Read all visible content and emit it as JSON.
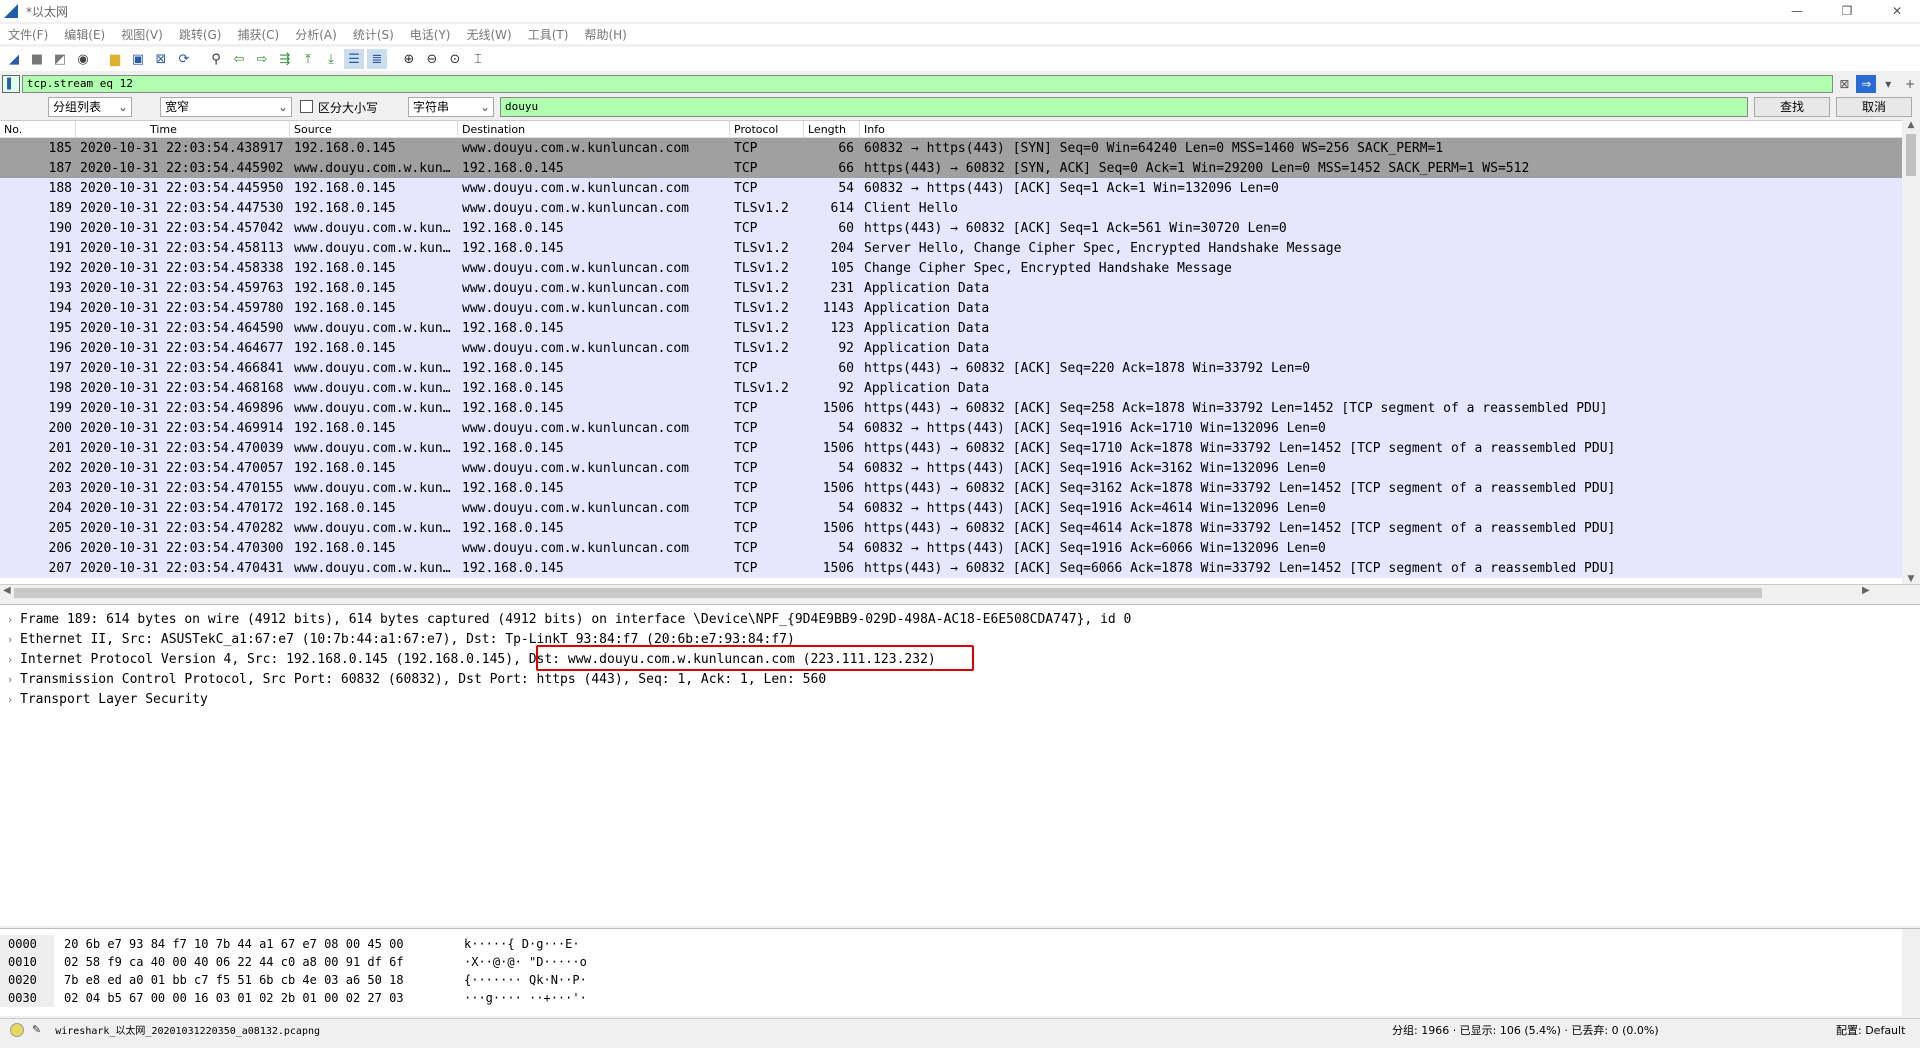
{
  "window": {
    "title": "*以太网",
    "minimize": "—",
    "restore": "❐",
    "close": "✕"
  },
  "menu": [
    "文件(F)",
    "编辑(E)",
    "视图(V)",
    "跳转(G)",
    "捕获(C)",
    "分析(A)",
    "统计(S)",
    "电话(Y)",
    "无线(W)",
    "工具(T)",
    "帮助(H)"
  ],
  "filter": {
    "value": "tcp.stream eq 12"
  },
  "find": {
    "scope": "分组列表",
    "charset": "宽窄",
    "case_label": "区分大小写",
    "type": "字符串",
    "query": "douyu",
    "find_button": "查找",
    "cancel_button": "取消"
  },
  "columns": {
    "no": "No.",
    "time": "Time",
    "source": "Source",
    "destination": "Destination",
    "protocol": "Protocol",
    "length": "Length",
    "info": "Info"
  },
  "packets": [
    {
      "no": "185",
      "time": "2020-10-31 22:03:54.438917",
      "src": "192.168.0.145",
      "dst": "www.douyu.com.w.kunluncan.com",
      "proto": "TCP",
      "len": "66",
      "info": "60832 → https(443) [SYN] Seq=0 Win=64240 Len=0 MSS=1460 WS=256 SACK_PERM=1"
    },
    {
      "no": "187",
      "time": "2020-10-31 22:03:54.445902",
      "src": "www.douyu.com.w.kun…",
      "dst": "192.168.0.145",
      "proto": "TCP",
      "len": "66",
      "info": "https(443) → 60832 [SYN, ACK] Seq=0 Ack=1 Win=29200 Len=0 MSS=1452 SACK_PERM=1 WS=512"
    },
    {
      "no": "188",
      "time": "2020-10-31 22:03:54.445950",
      "src": "192.168.0.145",
      "dst": "www.douyu.com.w.kunluncan.com",
      "proto": "TCP",
      "len": "54",
      "info": "60832 → https(443) [ACK] Seq=1 Ack=1 Win=132096 Len=0"
    },
    {
      "no": "189",
      "time": "2020-10-31 22:03:54.447530",
      "src": "192.168.0.145",
      "dst": "www.douyu.com.w.kunluncan.com",
      "proto": "TLSv1.2",
      "len": "614",
      "info": "Client Hello"
    },
    {
      "no": "190",
      "time": "2020-10-31 22:03:54.457042",
      "src": "www.douyu.com.w.kun…",
      "dst": "192.168.0.145",
      "proto": "TCP",
      "len": "60",
      "info": "https(443) → 60832 [ACK] Seq=1 Ack=561 Win=30720 Len=0"
    },
    {
      "no": "191",
      "time": "2020-10-31 22:03:54.458113",
      "src": "www.douyu.com.w.kun…",
      "dst": "192.168.0.145",
      "proto": "TLSv1.2",
      "len": "204",
      "info": "Server Hello, Change Cipher Spec, Encrypted Handshake Message"
    },
    {
      "no": "192",
      "time": "2020-10-31 22:03:54.458338",
      "src": "192.168.0.145",
      "dst": "www.douyu.com.w.kunluncan.com",
      "proto": "TLSv1.2",
      "len": "105",
      "info": "Change Cipher Spec, Encrypted Handshake Message"
    },
    {
      "no": "193",
      "time": "2020-10-31 22:03:54.459763",
      "src": "192.168.0.145",
      "dst": "www.douyu.com.w.kunluncan.com",
      "proto": "TLSv1.2",
      "len": "231",
      "info": "Application Data"
    },
    {
      "no": "194",
      "time": "2020-10-31 22:03:54.459780",
      "src": "192.168.0.145",
      "dst": "www.douyu.com.w.kunluncan.com",
      "proto": "TLSv1.2",
      "len": "1143",
      "info": "Application Data"
    },
    {
      "no": "195",
      "time": "2020-10-31 22:03:54.464590",
      "src": "www.douyu.com.w.kun…",
      "dst": "192.168.0.145",
      "proto": "TLSv1.2",
      "len": "123",
      "info": "Application Data"
    },
    {
      "no": "196",
      "time": "2020-10-31 22:03:54.464677",
      "src": "192.168.0.145",
      "dst": "www.douyu.com.w.kunluncan.com",
      "proto": "TLSv1.2",
      "len": "92",
      "info": "Application Data"
    },
    {
      "no": "197",
      "time": "2020-10-31 22:03:54.466841",
      "src": "www.douyu.com.w.kun…",
      "dst": "192.168.0.145",
      "proto": "TCP",
      "len": "60",
      "info": "https(443) → 60832 [ACK] Seq=220 Ack=1878 Win=33792 Len=0"
    },
    {
      "no": "198",
      "time": "2020-10-31 22:03:54.468168",
      "src": "www.douyu.com.w.kun…",
      "dst": "192.168.0.145",
      "proto": "TLSv1.2",
      "len": "92",
      "info": "Application Data"
    },
    {
      "no": "199",
      "time": "2020-10-31 22:03:54.469896",
      "src": "www.douyu.com.w.kun…",
      "dst": "192.168.0.145",
      "proto": "TCP",
      "len": "1506",
      "info": "https(443) → 60832 [ACK] Seq=258 Ack=1878 Win=33792 Len=1452 [TCP segment of a reassembled PDU]"
    },
    {
      "no": "200",
      "time": "2020-10-31 22:03:54.469914",
      "src": "192.168.0.145",
      "dst": "www.douyu.com.w.kunluncan.com",
      "proto": "TCP",
      "len": "54",
      "info": "60832 → https(443) [ACK] Seq=1916 Ack=1710 Win=132096 Len=0"
    },
    {
      "no": "201",
      "time": "2020-10-31 22:03:54.470039",
      "src": "www.douyu.com.w.kun…",
      "dst": "192.168.0.145",
      "proto": "TCP",
      "len": "1506",
      "info": "https(443) → 60832 [ACK] Seq=1710 Ack=1878 Win=33792 Len=1452 [TCP segment of a reassembled PDU]"
    },
    {
      "no": "202",
      "time": "2020-10-31 22:03:54.470057",
      "src": "192.168.0.145",
      "dst": "www.douyu.com.w.kunluncan.com",
      "proto": "TCP",
      "len": "54",
      "info": "60832 → https(443) [ACK] Seq=1916 Ack=3162 Win=132096 Len=0"
    },
    {
      "no": "203",
      "time": "2020-10-31 22:03:54.470155",
      "src": "www.douyu.com.w.kun…",
      "dst": "192.168.0.145",
      "proto": "TCP",
      "len": "1506",
      "info": "https(443) → 60832 [ACK] Seq=3162 Ack=1878 Win=33792 Len=1452 [TCP segment of a reassembled PDU]"
    },
    {
      "no": "204",
      "time": "2020-10-31 22:03:54.470172",
      "src": "192.168.0.145",
      "dst": "www.douyu.com.w.kunluncan.com",
      "proto": "TCP",
      "len": "54",
      "info": "60832 → https(443) [ACK] Seq=1916 Ack=4614 Win=132096 Len=0"
    },
    {
      "no": "205",
      "time": "2020-10-31 22:03:54.470282",
      "src": "www.douyu.com.w.kun…",
      "dst": "192.168.0.145",
      "proto": "TCP",
      "len": "1506",
      "info": "https(443) → 60832 [ACK] Seq=4614 Ack=1878 Win=33792 Len=1452 [TCP segment of a reassembled PDU]"
    },
    {
      "no": "206",
      "time": "2020-10-31 22:03:54.470300",
      "src": "192.168.0.145",
      "dst": "www.douyu.com.w.kunluncan.com",
      "proto": "TCP",
      "len": "54",
      "info": "60832 → https(443) [ACK] Seq=1916 Ack=6066 Win=132096 Len=0"
    },
    {
      "no": "207",
      "time": "2020-10-31 22:03:54.470431",
      "src": "www.douyu.com.w.kun…",
      "dst": "192.168.0.145",
      "proto": "TCP",
      "len": "1506",
      "info": "https(443) → 60832 [ACK] Seq=6066 Ack=1878 Win=33792 Len=1452 [TCP segment of a reassembled PDU]"
    }
  ],
  "details": [
    "Frame 189: 614 bytes on wire (4912 bits), 614 bytes captured (4912 bits) on interface \\Device\\NPF_{9D4E9BB9-029D-498A-AC18-E6E508CDA747}, id 0",
    "Ethernet II, Src: ASUSTekC_a1:67:e7 (10:7b:44:a1:67:e7), Dst: Tp-LinkT_93:84:f7 (20:6b:e7:93:84:f7)",
    "Internet Protocol Version 4, Src: 192.168.0.145 (192.168.0.145), Dst: www.douyu.com.w.kunluncan.com (223.111.123.232)",
    "Transmission Control Protocol, Src Port: 60832 (60832), Dst Port: https (443), Seq: 1, Ack: 1, Len: 560",
    "Transport Layer Security"
  ],
  "bytes": [
    {
      "offset": "0000",
      "hex": "20 6b e7 93 84 f7 10 7b  44 a1 67 e7 08 00 45 00",
      "ascii": " k·····{ D·g···E·"
    },
    {
      "offset": "0010",
      "hex": "02 58 f9 ca 40 00 40 06  22 44 c0 a8 00 91 df 6f",
      "ascii": "·X··@·@· \"D·····o"
    },
    {
      "offset": "0020",
      "hex": "7b e8 ed a0 01 bb c7 f5  51 6b cb 4e 03 a6 50 18",
      "ascii": "{······· Qk·N··P·"
    },
    {
      "offset": "0030",
      "hex": "02 04 b5 67 00 00 16 03  01 02 2b 01 00 02 27 03",
      "ascii": "···g···· ··+···'·"
    }
  ],
  "status": {
    "file": "wireshark_以太网_20201031220350_a08132.pcapng",
    "packets": "分组: 1966 · 已显示: 106 (5.4%) · 已丢弃: 0 (0.0%)",
    "profile": "配置: Default"
  }
}
